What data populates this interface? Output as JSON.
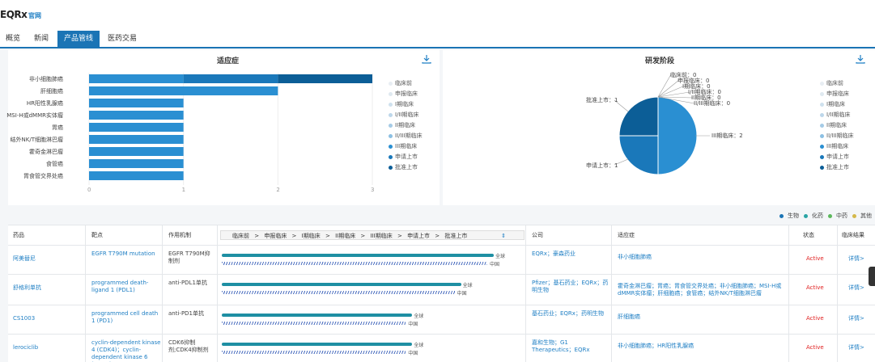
{
  "header": {
    "title": "EQRx",
    "official": "官网"
  },
  "tabs": [
    "概览",
    "新闻",
    "产品管线",
    "医药交易"
  ],
  "active_tab": 2,
  "indication_chart": {
    "title": "适应症",
    "categories": [
      "非小细胞肺癌",
      "肝细胞癌",
      "HR阳性乳腺癌",
      "MSI-H或dMMR实体瘤",
      "胃癌",
      "结外NK/T细胞淋巴瘤",
      "霍奇金淋巴瘤",
      "食管癌",
      "胃食管交界处癌"
    ],
    "legend": [
      "临床前",
      "申报临床",
      "I期临床",
      "I/II期临床",
      "II期临床",
      "II/III期临床",
      "III期临床",
      "申请上市",
      "批准上市"
    ],
    "legend_colors": [
      "#e8eef3",
      "#dfe9f0",
      "#cfe1ee",
      "#bdd7ea",
      "#a5cbe6",
      "#8cc0e3",
      "#2a8fd2",
      "#1a78ba",
      "#0c5e97"
    ]
  },
  "stage_chart": {
    "title": "研发阶段",
    "legend": [
      "临床前",
      "申报临床",
      "I期临床",
      "I/II期临床",
      "II期临床",
      "II/III期临床",
      "III期临床",
      "申请上市",
      "批准上市"
    ],
    "legend_colors": [
      "#e8eef3",
      "#dfe9f0",
      "#cfe1ee",
      "#bdd7ea",
      "#a5cbe6",
      "#8cc0e3",
      "#2a8fd2",
      "#1a78ba",
      "#0c5e97"
    ],
    "pie_labels": [
      "临床前：0",
      "申报临床：0",
      "I期临床：0",
      "I/II期临床：0",
      "II期临床：0",
      "II/III期临床：0",
      "III期临床：2",
      "申请上市：1",
      "批准上市：1"
    ]
  },
  "chart_data": [
    {
      "type": "bar",
      "title": "适应症",
      "categories": [
        "非小细胞肺癌",
        "肝细胞癌",
        "HR阳性乳腺癌",
        "MSI-H或dMMR实体瘤",
        "胃癌",
        "结外NK/T细胞淋巴瘤",
        "霍奇金淋巴瘤",
        "食管癌",
        "胃食管交界处癌"
      ],
      "series": [
        {
          "name": "III期临床",
          "values": [
            1,
            2,
            1,
            1,
            1,
            1,
            1,
            1,
            1
          ]
        },
        {
          "name": "申请上市",
          "values": [
            1,
            0,
            0,
            0,
            0,
            0,
            0,
            0,
            0
          ]
        },
        {
          "name": "批准上市",
          "values": [
            1,
            0,
            0,
            0,
            0,
            0,
            0,
            0,
            0
          ]
        }
      ],
      "xticks": [
        "0",
        "1",
        "2",
        "3"
      ],
      "xlim": [
        0,
        3
      ]
    },
    {
      "type": "pie",
      "title": "研发阶段",
      "categories": [
        "临床前",
        "申报临床",
        "I期临床",
        "I/II期临床",
        "II期临床",
        "II/III期临床",
        "III期临床",
        "申请上市",
        "批准上市"
      ],
      "values": [
        0,
        0,
        0,
        0,
        0,
        0,
        2,
        1,
        1
      ]
    }
  ],
  "type_legend": [
    {
      "label": "生物",
      "color": "#1b74b5"
    },
    {
      "label": "化药",
      "color": "#2aa4a4"
    },
    {
      "label": "中药",
      "color": "#5cb85c"
    },
    {
      "label": "其他",
      "color": "#d4b84a"
    }
  ],
  "table": {
    "headers": {
      "drug": "药品",
      "target": "靶点",
      "mechanism": "作用机制",
      "company": "公司",
      "indication": "适应症",
      "status": "状态",
      "result": "临床结果"
    },
    "stages": [
      "临床前",
      "申报临床",
      "I期临床",
      "II期临床",
      "III期临床",
      "申请上市",
      "批准上市"
    ],
    "rows": [
      {
        "drug": "阿美替尼",
        "target": "EGFR T790M mutation",
        "mechanism": "EGFR T790M抑制剂",
        "bar": 1.0,
        "global": "全球",
        "china": "中国",
        "company": "EQRx；豪森药业",
        "indication": "非小细胞肺癌",
        "status": "Active",
        "detail": "详情>"
      },
      {
        "drug": "舒格利单抗",
        "target": "programmed death-ligand 1 (PDL1)",
        "mechanism": "anti-PDL1单抗",
        "bar": 0.88,
        "global": "全球",
        "china": "中国",
        "company": "Pfizer；基石药业；EQRx；药明生物",
        "indication": "霍奇金淋巴瘤；胃癌；胃食管交界处癌；非小细胞肺癌；MSI-H或dMMR实体瘤；肝细胞癌；食管癌；结外NK/T细胞淋巴瘤",
        "status": "Active",
        "detail": "详情>"
      },
      {
        "drug": "CS1003",
        "target": "programmed cell death 1 (PD1)",
        "mechanism": "anti-PD1单抗",
        "bar": 0.7,
        "global": "全球",
        "china": "中国",
        "company": "基石药业；EQRx；药明生物",
        "indication": "肝细胞癌",
        "status": "Active",
        "detail": "详情>"
      },
      {
        "drug": "lerociclib",
        "target": "cyclin-dependent kinase 4 (CDK4)；cyclin-dependent kinase 6 (CDK6)",
        "mechanism": "CDK6抑制剂;CDK4抑制剂",
        "bar": 0.7,
        "global": "全球",
        "china": "中国",
        "company": "嘉和生物；G1 Therapeutics；EQRx",
        "indication": "非小细胞肺癌；HR阳性乳腺癌",
        "status": "Active",
        "detail": "详情>"
      }
    ]
  }
}
